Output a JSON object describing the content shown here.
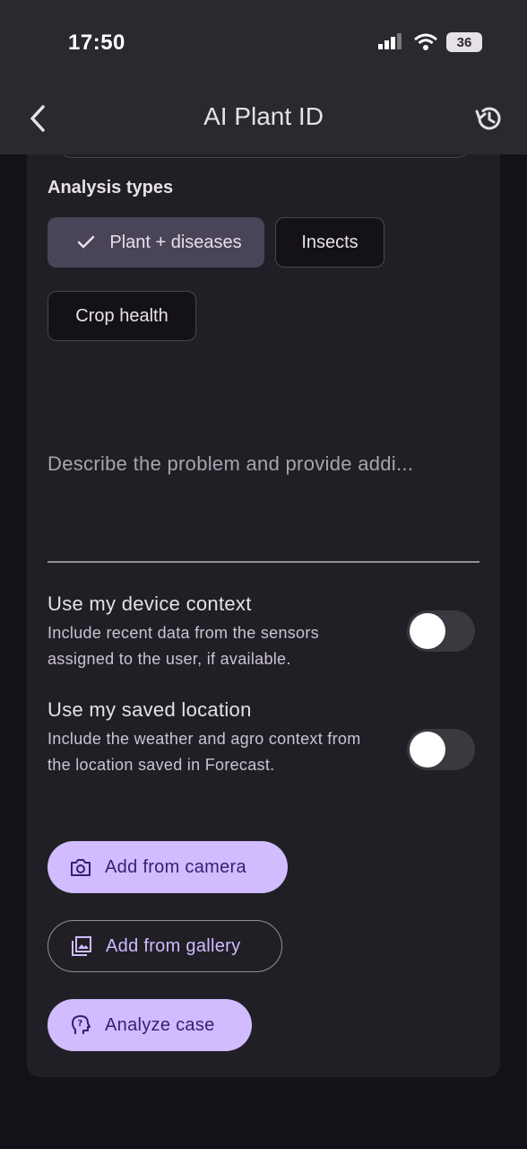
{
  "status_bar": {
    "time": "17:50",
    "battery": "36"
  },
  "header": {
    "title": "AI Plant ID"
  },
  "analysis": {
    "section_title": "Analysis types",
    "chips": [
      {
        "label": "Plant + diseases",
        "selected": true
      },
      {
        "label": "Insects",
        "selected": false
      },
      {
        "label": "Crop health",
        "selected": false
      }
    ]
  },
  "description": {
    "placeholder": "Describe the problem and provide addi..."
  },
  "settings": [
    {
      "title": "Use my device context",
      "description": "Include recent data from the sensors assigned to the user, if available.",
      "enabled": false
    },
    {
      "title": "Use my saved location",
      "description": "Include the weather and agro context from the location saved in Forecast.",
      "enabled": false
    }
  ],
  "buttons": {
    "camera": "Add from camera",
    "gallery": "Add from gallery",
    "analyze": "Analyze case"
  },
  "colors": {
    "accent": "#d0bcff",
    "surface": "#211f26",
    "background": "#141218"
  }
}
